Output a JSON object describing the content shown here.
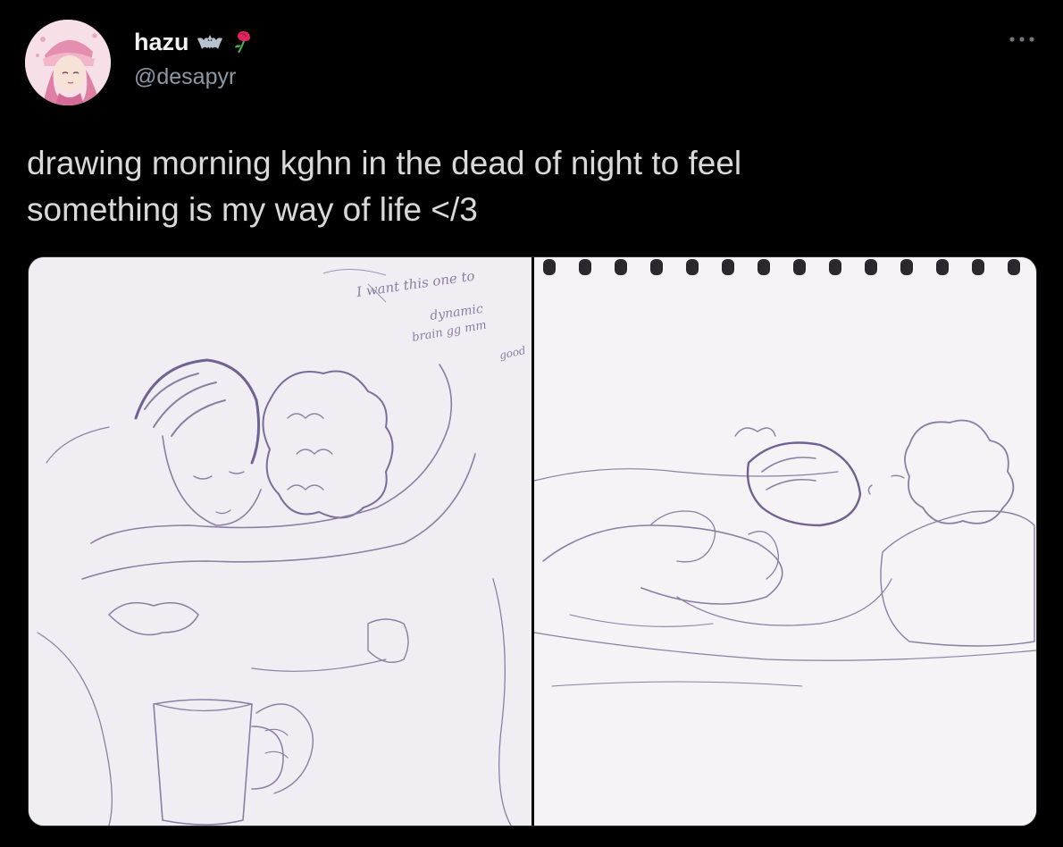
{
  "author": {
    "display_name": "hazu",
    "handle": "@desapyr",
    "avatar_icon": "avatar-illustration",
    "badges": [
      "bat-icon",
      "rose-icon"
    ]
  },
  "more_icon": "more-dots-icon",
  "tweet": {
    "text_line1": "drawing morning kghn in the dead of night to feel",
    "text_line2": "something is my way of life </3"
  },
  "media": {
    "left_image": {
      "icon": "sketch-hug-image",
      "handwritten_note": [
        "I want this one to",
        "dynamic",
        "brain gg mm",
        "good"
      ]
    },
    "right_image": {
      "icon": "sketch-sleeping-image"
    }
  },
  "colors": {
    "background": "#000000",
    "text": "#d9d9d9",
    "handle": "#8b98a5",
    "sketch_line": "#8a7fa3",
    "paper": "#f1eef3"
  }
}
